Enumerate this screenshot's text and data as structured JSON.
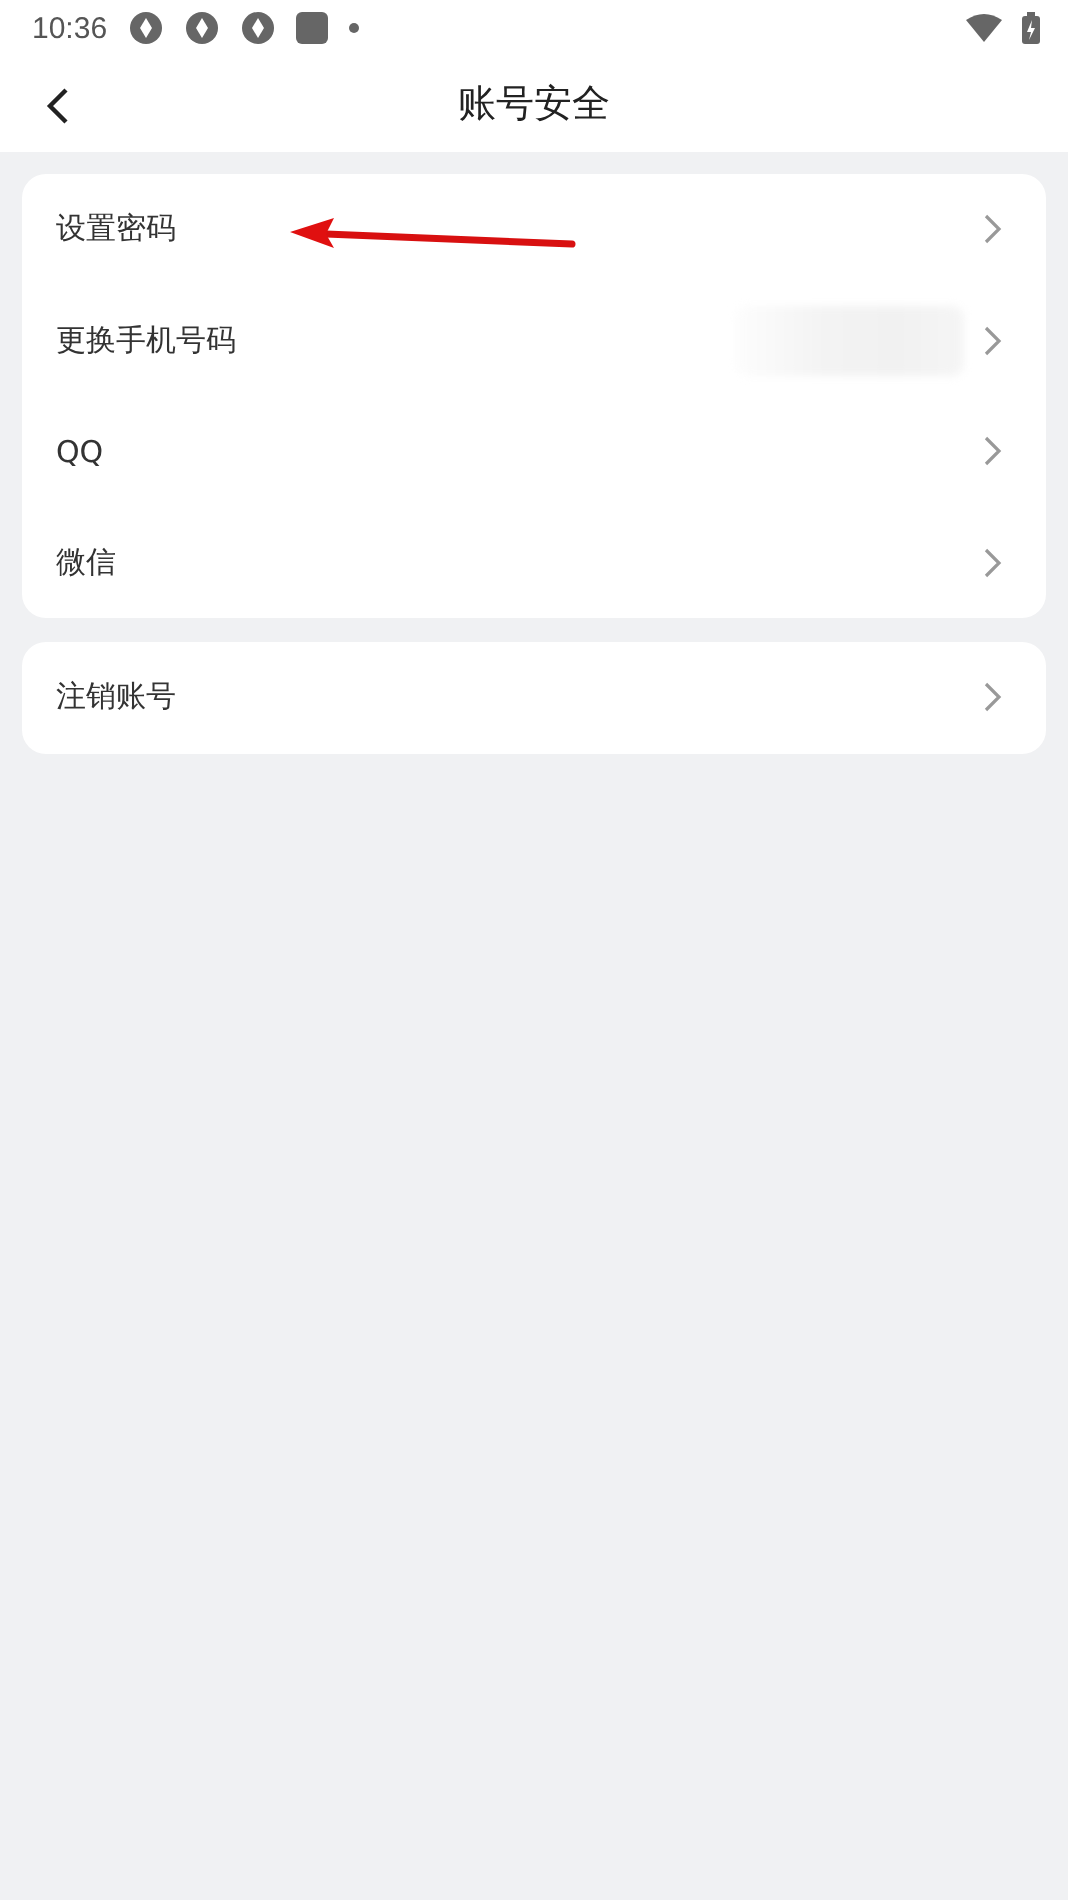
{
  "status_bar": {
    "time": "10:36"
  },
  "header": {
    "title": "账号安全"
  },
  "groups": [
    {
      "items": [
        {
          "label": "设置密码",
          "kind": "plain"
        },
        {
          "label": "更换手机号码",
          "kind": "masked"
        },
        {
          "label": "QQ",
          "kind": "plain"
        },
        {
          "label": "微信",
          "kind": "plain"
        }
      ]
    },
    {
      "items": [
        {
          "label": "注销账号",
          "kind": "plain"
        }
      ]
    }
  ]
}
